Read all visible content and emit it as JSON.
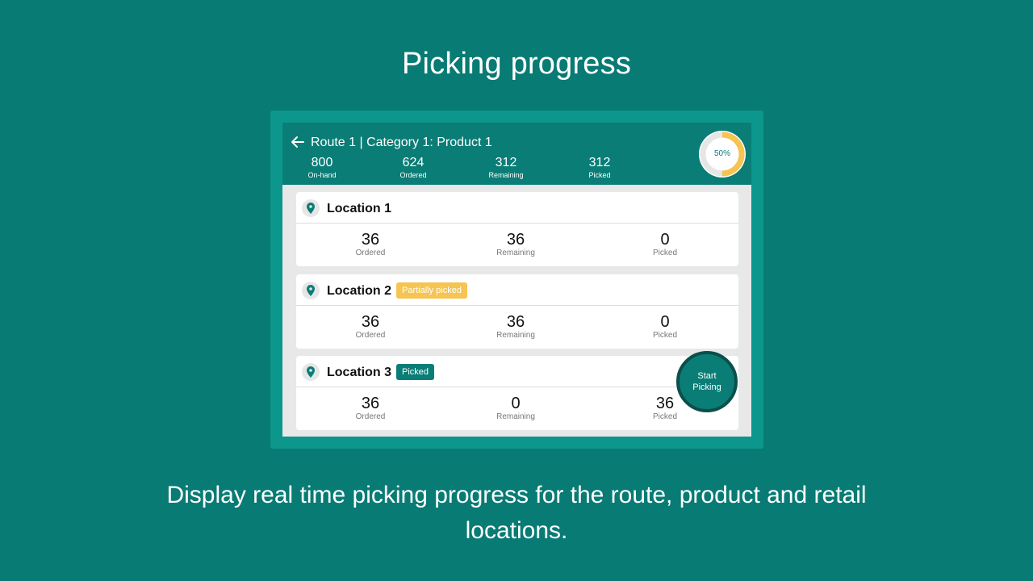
{
  "page": {
    "title": "Picking progress",
    "caption": "Display real time picking progress for the route, product and retail locations."
  },
  "header": {
    "title": "Route 1 | Category 1: Product 1",
    "stats": [
      {
        "value": "800",
        "label": "On-hand"
      },
      {
        "value": "624",
        "label": "Ordered"
      },
      {
        "value": "312",
        "label": "Remaining"
      },
      {
        "value": "312",
        "label": "Picked"
      }
    ],
    "progress_label": "50%",
    "progress_fraction": 0.5
  },
  "locations": [
    {
      "name": "Location 1",
      "badge": "",
      "stats": [
        {
          "value": "36",
          "label": "Ordered"
        },
        {
          "value": "36",
          "label": "Remaining"
        },
        {
          "value": "0",
          "label": "Picked"
        }
      ]
    },
    {
      "name": "Location 2",
      "badge": "Partially picked",
      "stats": [
        {
          "value": "36",
          "label": "Ordered"
        },
        {
          "value": "36",
          "label": "Remaining"
        },
        {
          "value": "0",
          "label": "Picked"
        }
      ]
    },
    {
      "name": "Location 3",
      "badge": "Picked",
      "stats": [
        {
          "value": "36",
          "label": "Ordered"
        },
        {
          "value": "0",
          "label": "Remaining"
        },
        {
          "value": "36",
          "label": "Picked"
        }
      ]
    }
  ],
  "fab": {
    "line1": "Start",
    "line2": "Picking"
  },
  "colors": {
    "background": "#087b74",
    "frame": "#0d968c",
    "header": "#0a7d76",
    "progress_fill": "#f5c451",
    "progress_track": "#e6e6e6",
    "badge_partial": "#f5c451",
    "badge_picked": "#0a7d76"
  },
  "icons": {
    "back": "arrow-left-icon",
    "location": "map-pin-icon"
  }
}
